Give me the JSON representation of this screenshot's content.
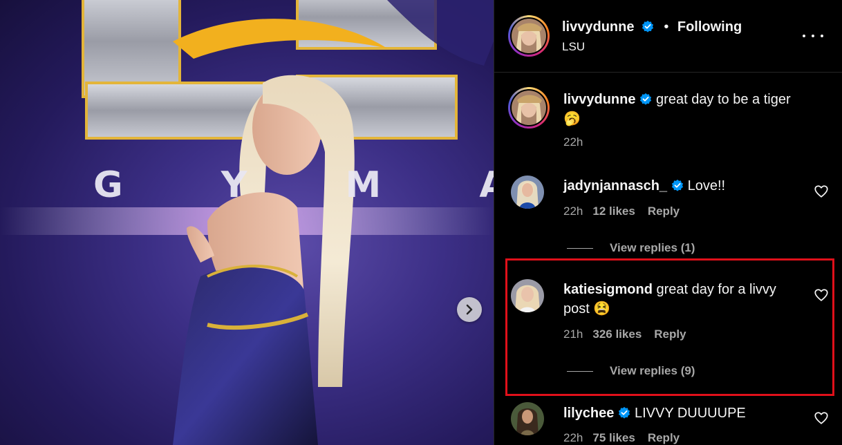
{
  "post": {
    "username": "livvydunne",
    "follow_status": "Following",
    "separator": "•",
    "location": "LSU",
    "caption": {
      "username": "livvydunne",
      "text": "great day to be a tiger",
      "emoji": "🥱",
      "time": "22h"
    }
  },
  "photo": {
    "backdrop_text": "G Y M  A S",
    "next_icon": "chevron-right-icon"
  },
  "comments": [
    {
      "username": "jadynjannasch_",
      "verified": true,
      "text": "Love!!",
      "time": "22h",
      "likes": "12 likes",
      "reply": "Reply",
      "view_replies": "View replies (1)"
    },
    {
      "username": "katiesigmond",
      "verified": false,
      "text": "great day for a livvy post",
      "emoji": "😫",
      "time": "21h",
      "likes": "326 likes",
      "reply": "Reply",
      "view_replies": "View replies (9)"
    },
    {
      "username": "lilychee",
      "verified": true,
      "text": "LIVVY DUUUUPE",
      "time": "22h",
      "likes": "75 likes",
      "reply": "Reply"
    }
  ],
  "colors": {
    "verified": "#0095f6",
    "highlight": "#e0101a",
    "muted": "#a8a8a8"
  }
}
